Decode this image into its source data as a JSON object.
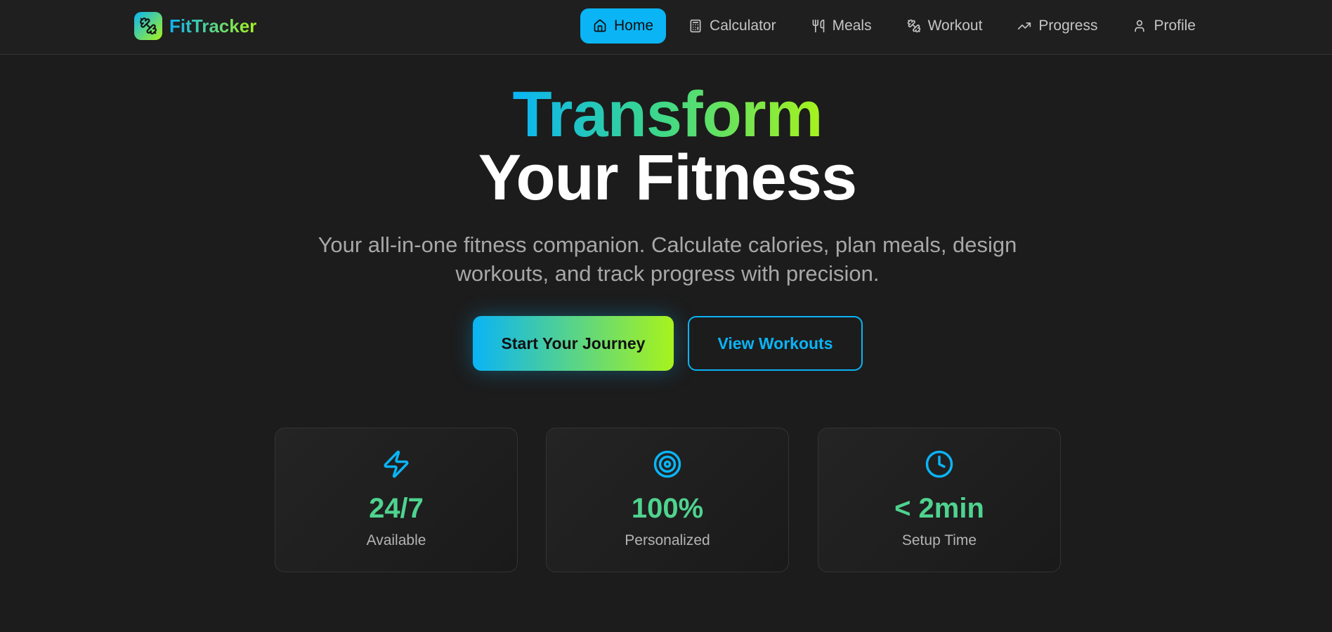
{
  "brand": {
    "name": "FitTracker",
    "logo_icon": "dumbbell-icon"
  },
  "nav": {
    "items": [
      {
        "label": "Home",
        "icon": "home-icon",
        "active": true
      },
      {
        "label": "Calculator",
        "icon": "calculator-icon",
        "active": false
      },
      {
        "label": "Meals",
        "icon": "utensils-icon",
        "active": false
      },
      {
        "label": "Workout",
        "icon": "dumbbell-icon",
        "active": false
      },
      {
        "label": "Progress",
        "icon": "trending-up-icon",
        "active": false
      },
      {
        "label": "Profile",
        "icon": "user-icon",
        "active": false
      }
    ]
  },
  "hero": {
    "title_line1": "Transform",
    "title_line2": "Your Fitness",
    "subtitle": "Your all-in-one fitness companion. Calculate calories, plan meals, design workouts, and track progress with precision.",
    "primary_button": "Start Your Journey",
    "secondary_button": "View Workouts"
  },
  "stats": [
    {
      "value": "24/7",
      "label": "Available",
      "icon": "lightning-icon"
    },
    {
      "value": "100%",
      "label": "Personalized",
      "icon": "target-icon"
    },
    {
      "value": "< 2min",
      "label": "Setup Time",
      "icon": "clock-icon"
    }
  ],
  "colors": {
    "accent_blue": "#0ab4f5",
    "accent_lime": "#a7f31c",
    "stat_green": "#4fd38f",
    "background": "#1c1c1c"
  }
}
